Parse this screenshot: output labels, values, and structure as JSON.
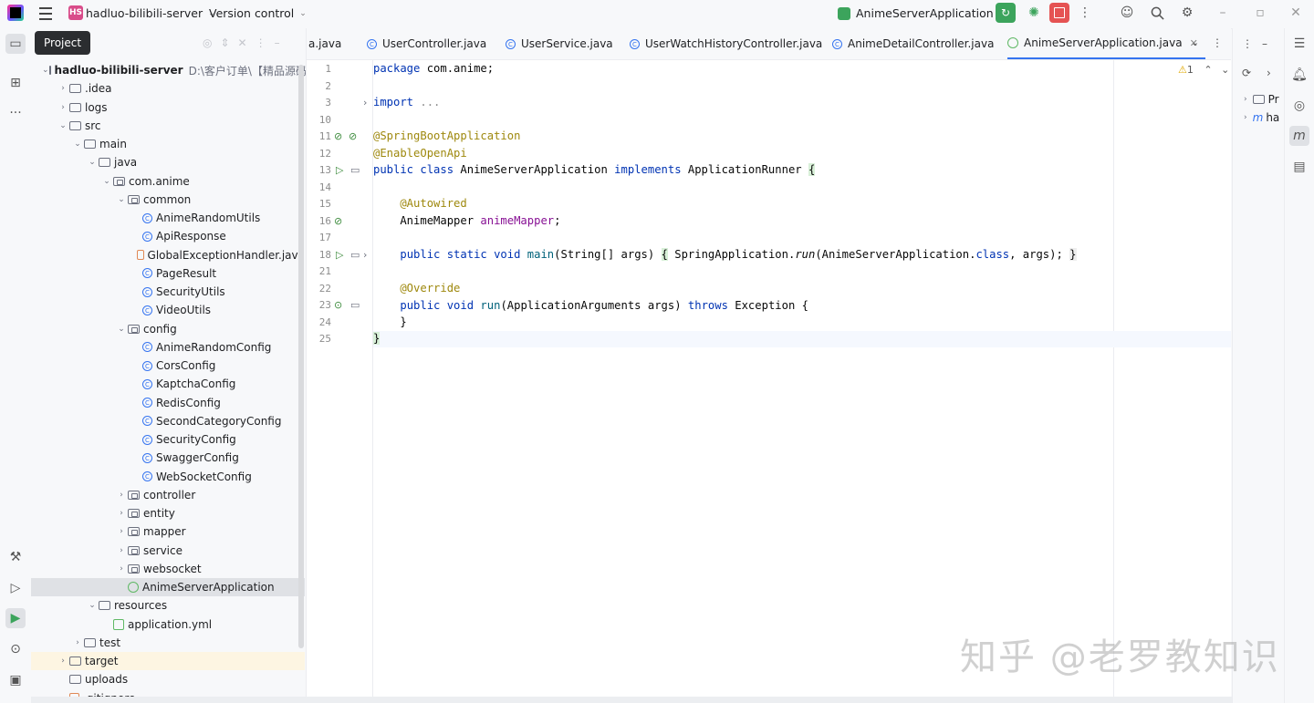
{
  "titlebar": {
    "project_badge": "HS",
    "project_name": "hadluo-bilibili-server",
    "vcs_label": "Version control",
    "run_config": "AnimeServerApplication"
  },
  "tooltip": "Project",
  "tree": {
    "root_name": "hadluo-bilibili-server",
    "root_path": "D:\\客户订单\\【精品源码系列",
    "items": [
      {
        "label": ".idea",
        "depth": 1,
        "kind": "folder",
        "arrow": "›"
      },
      {
        "label": "logs",
        "depth": 1,
        "kind": "folder",
        "arrow": "›"
      },
      {
        "label": "src",
        "depth": 1,
        "kind": "folder",
        "arrow": "⌄"
      },
      {
        "label": "main",
        "depth": 2,
        "kind": "folder",
        "arrow": "⌄"
      },
      {
        "label": "java",
        "depth": 3,
        "kind": "folder",
        "arrow": "⌄"
      },
      {
        "label": "com.anime",
        "depth": 4,
        "kind": "pkg",
        "arrow": "⌄"
      },
      {
        "label": "common",
        "depth": 5,
        "kind": "pkg",
        "arrow": "⌄"
      },
      {
        "label": "AnimeRandomUtils",
        "depth": 6,
        "kind": "class",
        "arrow": ""
      },
      {
        "label": "ApiResponse",
        "depth": 6,
        "kind": "class",
        "arrow": ""
      },
      {
        "label": "GlobalExceptionHandler.java",
        "depth": 6,
        "kind": "exc",
        "arrow": ""
      },
      {
        "label": "PageResult",
        "depth": 6,
        "kind": "class",
        "arrow": ""
      },
      {
        "label": "SecurityUtils",
        "depth": 6,
        "kind": "class",
        "arrow": ""
      },
      {
        "label": "VideoUtils",
        "depth": 6,
        "kind": "class",
        "arrow": ""
      },
      {
        "label": "config",
        "depth": 5,
        "kind": "pkg",
        "arrow": "⌄"
      },
      {
        "label": "AnimeRandomConfig",
        "depth": 6,
        "kind": "class",
        "arrow": ""
      },
      {
        "label": "CorsConfig",
        "depth": 6,
        "kind": "class",
        "arrow": ""
      },
      {
        "label": "KaptchaConfig",
        "depth": 6,
        "kind": "class",
        "arrow": ""
      },
      {
        "label": "RedisConfig",
        "depth": 6,
        "kind": "class",
        "arrow": ""
      },
      {
        "label": "SecondCategoryConfig",
        "depth": 6,
        "kind": "class",
        "arrow": ""
      },
      {
        "label": "SecurityConfig",
        "depth": 6,
        "kind": "class",
        "arrow": ""
      },
      {
        "label": "SwaggerConfig",
        "depth": 6,
        "kind": "class",
        "arrow": ""
      },
      {
        "label": "WebSocketConfig",
        "depth": 6,
        "kind": "class",
        "arrow": ""
      },
      {
        "label": "controller",
        "depth": 5,
        "kind": "pkg",
        "arrow": "›"
      },
      {
        "label": "entity",
        "depth": 5,
        "kind": "pkg",
        "arrow": "›"
      },
      {
        "label": "mapper",
        "depth": 5,
        "kind": "pkg",
        "arrow": "›"
      },
      {
        "label": "service",
        "depth": 5,
        "kind": "pkg",
        "arrow": "›"
      },
      {
        "label": "websocket",
        "depth": 5,
        "kind": "pkg",
        "arrow": "›"
      },
      {
        "label": "AnimeServerApplication",
        "depth": 5,
        "kind": "spring",
        "arrow": "",
        "selected": true
      },
      {
        "label": "resources",
        "depth": 3,
        "kind": "res",
        "arrow": "⌄"
      },
      {
        "label": "application.yml",
        "depth": 4,
        "kind": "yml",
        "arrow": ""
      },
      {
        "label": "test",
        "depth": 2,
        "kind": "folder",
        "arrow": "›"
      },
      {
        "label": "target",
        "depth": 1,
        "kind": "folder",
        "arrow": "›",
        "highlight": true
      },
      {
        "label": "uploads",
        "depth": 1,
        "kind": "folder",
        "arrow": ""
      },
      {
        "label": ".gitignore",
        "depth": 1,
        "kind": "file",
        "arrow": ""
      }
    ]
  },
  "tabs": [
    {
      "label": "a.java",
      "active": false
    },
    {
      "label": "UserController.java",
      "active": false
    },
    {
      "label": "UserService.java",
      "active": false
    },
    {
      "label": "UserWatchHistoryController.java",
      "active": false
    },
    {
      "label": "AnimeDetailController.java",
      "active": false
    },
    {
      "label": "AnimeServerApplication.java",
      "active": true
    }
  ],
  "editor": {
    "warning_count": "1",
    "line_numbers": [
      "1",
      "2",
      "3",
      "10",
      "11",
      "12",
      "13",
      "14",
      "15",
      "16",
      "17",
      "18",
      "21",
      "22",
      "23",
      "24",
      "25"
    ]
  },
  "rightpanel": {
    "item1": "Pr",
    "item2": "ha"
  },
  "watermark": "知乎 @老罗教知识",
  "colors": {
    "accent": "#3574f0",
    "run_green": "#3ca45c",
    "stop_red": "#e55353",
    "annotation": "#9e880d",
    "keyword": "#0033b3"
  }
}
